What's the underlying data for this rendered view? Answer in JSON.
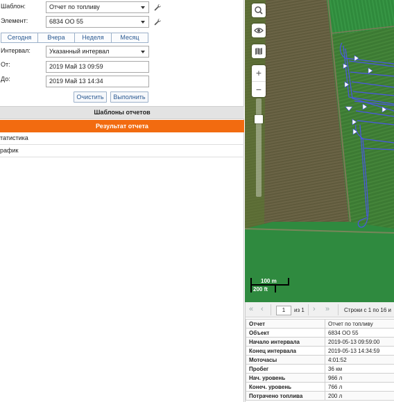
{
  "form": {
    "template_label": "Шаблон:",
    "template_value": "Отчет по топливу",
    "element_label": "Элемент:",
    "element_value": "6834 ОО 55",
    "interval_label": "Интервал:",
    "interval_value": "Указанный интервал",
    "from_label": "От:",
    "from_value": "2019 Май 13 09:59",
    "to_label": "До:",
    "to_value": "2019 Май 13 14:34",
    "clear_label": "Очистить",
    "run_label": "Выполнить"
  },
  "tabs": [
    "Сегодня",
    "Вчера",
    "Неделя",
    "Месяц"
  ],
  "sections": {
    "templates_title": "Шаблоны отчетов",
    "result_title": "Результат отчета",
    "result_items": [
      "татистика",
      "рафик"
    ]
  },
  "map": {
    "scale_m": "100 m",
    "scale_ft": "200 ft",
    "controls": [
      "search-icon",
      "eye-icon",
      "map-icon",
      "zoom-in-icon",
      "zoom-out-icon"
    ]
  },
  "pager": {
    "page": "1",
    "of_text": "из 1",
    "rows_text": "Строки с 1 по 16 и"
  },
  "table": [
    {
      "key": "Отчет",
      "value": "Отчет по топливу"
    },
    {
      "key": "Объект",
      "value": "6834 ОО 55"
    },
    {
      "key": "Начало интервала",
      "value": "2019-05-13 09:59:00"
    },
    {
      "key": "Конец интервала",
      "value": "2019-05-13 14:34:59"
    },
    {
      "key": "Моточасы",
      "value": "4:01:52"
    },
    {
      "key": "Пробег",
      "value": "36 км"
    },
    {
      "key": "Нач. уровень",
      "value": "966 л"
    },
    {
      "key": "Конеч. уровень",
      "value": "766 л"
    },
    {
      "key": "Потрачено топлива",
      "value": "200 л"
    }
  ],
  "colors": {
    "accent": "#f26b10",
    "track": "#4a55e8"
  }
}
